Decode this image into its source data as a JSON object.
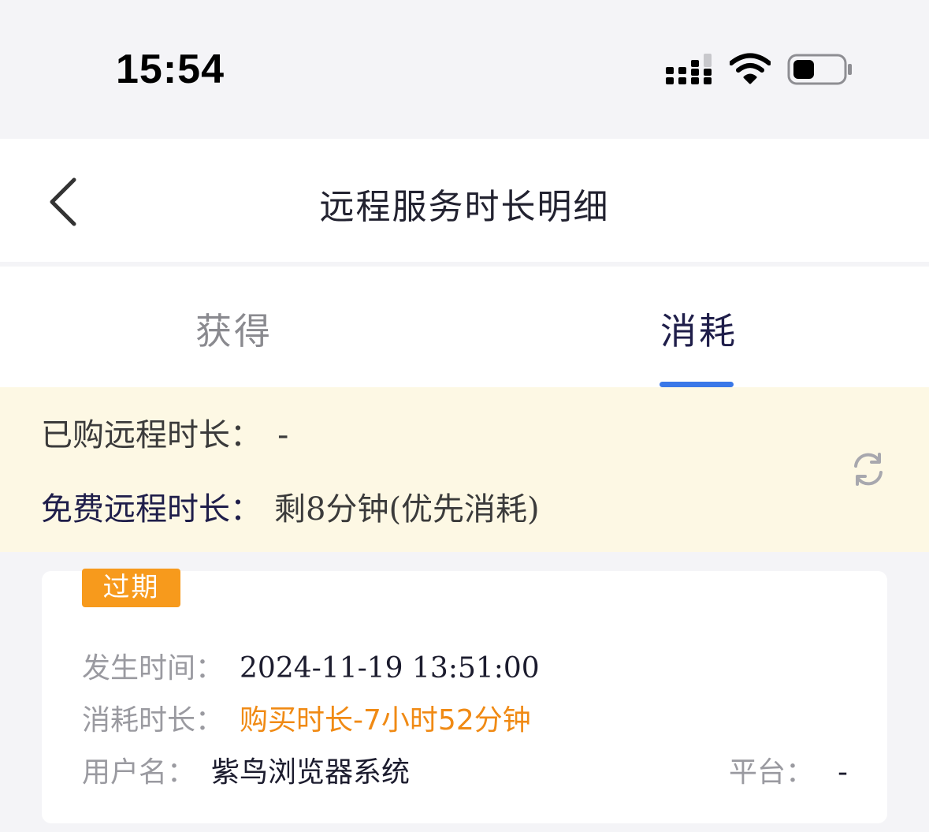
{
  "status_bar": {
    "time": "15:54",
    "signal_icon": "cellular-signal-icon",
    "wifi_icon": "wifi-icon",
    "battery_icon": "battery-icon"
  },
  "nav": {
    "back_icon": "chevron-left-icon",
    "title": "远程服务时长明细"
  },
  "tabs": [
    {
      "label": "获得",
      "active": false
    },
    {
      "label": "消耗",
      "active": true
    }
  ],
  "summary": {
    "purchased_label": "已购远程时长：",
    "purchased_value": "-",
    "free_label": "免费远程时长：",
    "free_value": "剩8分钟(优先消耗)",
    "refresh_icon": "refresh-icon"
  },
  "records": [
    {
      "badge": "过期",
      "time_label": "发生时间：",
      "time_value": "2024-11-19 13:51:00",
      "duration_label": "消耗时长：",
      "duration_value": "购买时长-7小时52分钟",
      "user_label": "用户名：",
      "user_value": "紫鸟浏览器系统",
      "platform_label": "平台：",
      "platform_value": "-"
    }
  ],
  "colors": {
    "accent": "#3a78e8",
    "badge": "#f79a1c",
    "highlight_text": "#f08a14",
    "banner_bg": "#fdf8e4"
  }
}
